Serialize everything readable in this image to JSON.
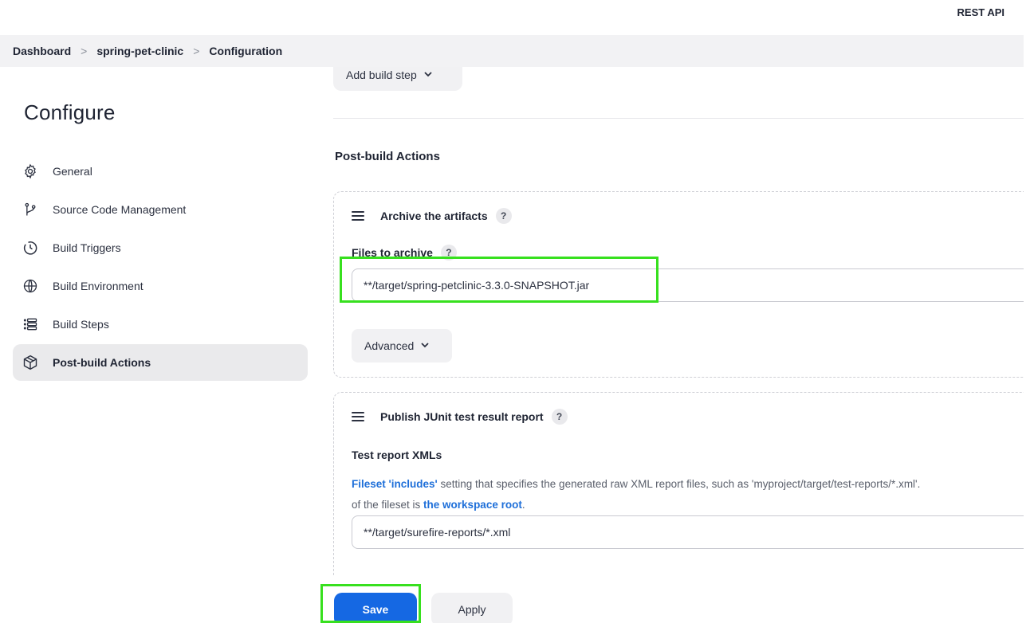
{
  "header": {
    "rest_api_link": "REST API"
  },
  "breadcrumb": {
    "items": [
      "Dashboard",
      "spring-pet-clinic",
      "Configuration"
    ],
    "separator": ">"
  },
  "sidebar": {
    "title": "Configure",
    "items": [
      {
        "label": "General",
        "icon": "gear-icon"
      },
      {
        "label": "Source Code Management",
        "icon": "branch-icon"
      },
      {
        "label": "Build Triggers",
        "icon": "clock-icon"
      },
      {
        "label": "Build Environment",
        "icon": "globe-icon"
      },
      {
        "label": "Build Steps",
        "icon": "list-icon"
      },
      {
        "label": "Post-build Actions",
        "icon": "package-icon",
        "active": true
      }
    ]
  },
  "main": {
    "add_build_step_label": "Add build step",
    "section_title": "Post-build Actions",
    "archive": {
      "title": "Archive the artifacts",
      "files_label": "Files to archive",
      "files_value": "**/target/spring-petclinic-3.3.0-SNAPSHOT.jar",
      "advanced_label": "Advanced"
    },
    "junit": {
      "title": "Publish JUnit test result report",
      "xml_label": "Test report XMLs",
      "help_link1": "Fileset 'includes'",
      "help_text1": " setting that specifies the generated raw XML report files, such as 'myproject/target/test-reports/*.xml'.",
      "help_text2": "of the fileset is ",
      "help_link2": "the workspace root",
      "help_text3": ".",
      "xml_value": "**/target/surefire-reports/*.xml"
    }
  },
  "footer": {
    "save_label": "Save",
    "apply_label": "Apply"
  },
  "help_glyph": "?",
  "colors": {
    "primary": "#1568e3",
    "highlight": "#37e01e",
    "link": "#1e6fd9"
  }
}
